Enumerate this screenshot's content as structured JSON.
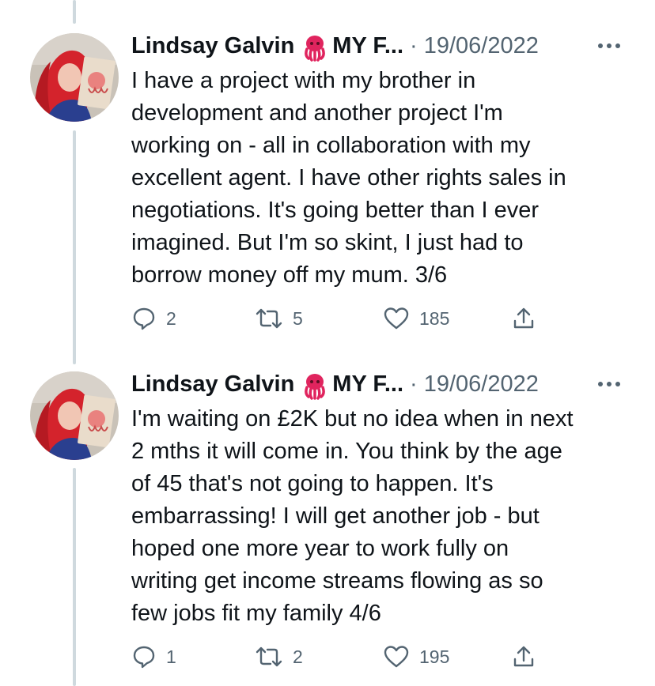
{
  "tweets": [
    {
      "author_name": "Lindsay Galvin",
      "author_suffix": "MY F...",
      "separator": "·",
      "date": "19/06/2022",
      "text": "I have a project with my brother in\ndevelopment and another project I'm\nworking on - all in collaboration with my\nexcellent agent. I have other rights sales in\nnegotiations. It's going better than I ever\nimagined. But I'm so skint, I just had to\nborrow money off my mum. 3/6",
      "replies": "2",
      "retweets": "5",
      "likes": "185"
    },
    {
      "author_name": "Lindsay Galvin",
      "author_suffix": "MY F...",
      "separator": "·",
      "date": "19/06/2022",
      "text": "I'm waiting on £2K but no idea when in next\n2 mths it will come in. You think by the age\nof 45 that's not going to happen. It's\nembarrassing! I will get another job - but\nhoped one more year to work fully on\nwriting get income streams flowing as so\nfew jobs fit my family 4/6",
      "replies": "1",
      "retweets": "2",
      "likes": "195"
    }
  ],
  "icons": {
    "author_emoji": "octopus-icon",
    "more": "more-dots-icon",
    "reply": "reply-bubble-icon",
    "retweet": "retweet-icon",
    "like": "heart-icon",
    "share": "share-icon"
  },
  "colors": {
    "text": "#0f1419",
    "muted": "#536471",
    "thread_line": "#cfd9de",
    "octopus": "#e0245e"
  }
}
